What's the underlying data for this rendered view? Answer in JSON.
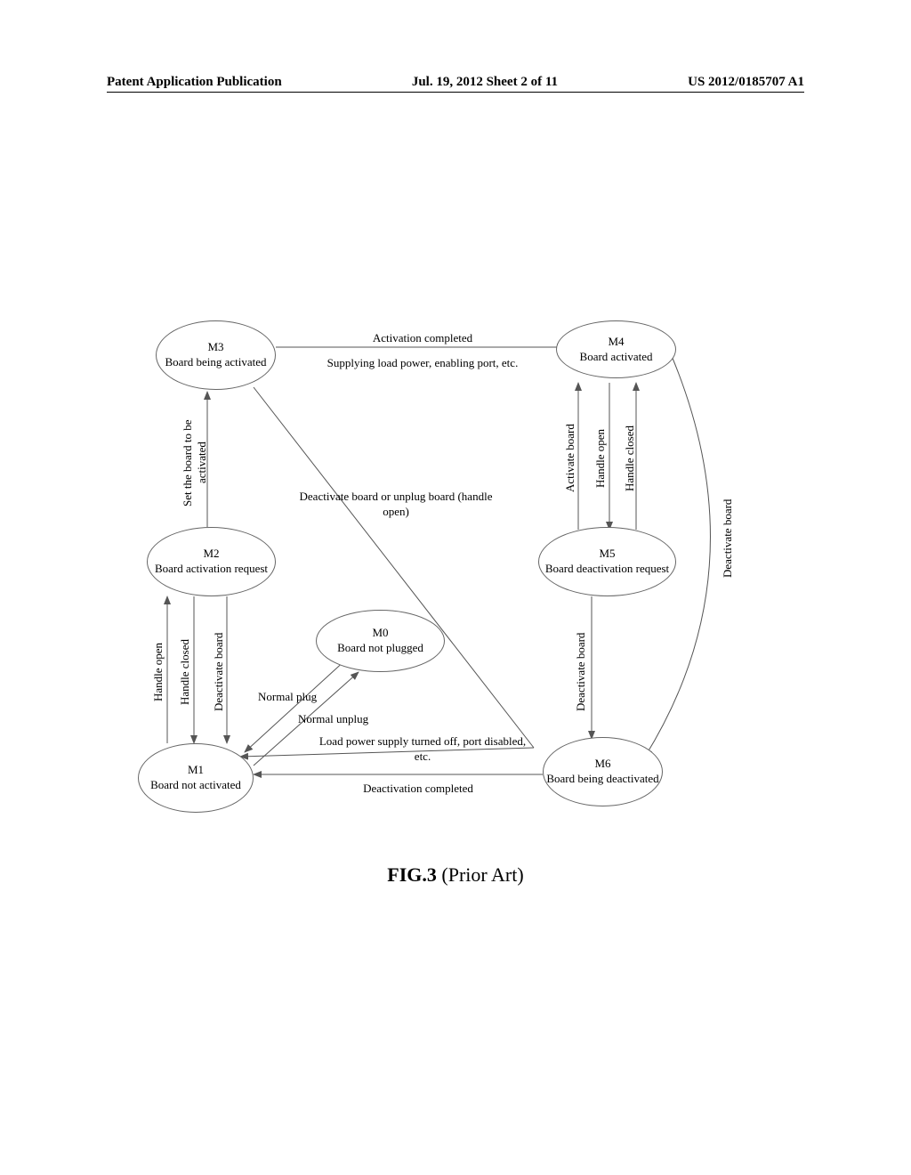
{
  "header": {
    "left": "Patent Application Publication",
    "center": "Jul. 19, 2012  Sheet 2 of 11",
    "right": "US 2012/0185707 A1"
  },
  "states": {
    "m0": {
      "id": "M0",
      "text": "Board not plugged"
    },
    "m1": {
      "id": "M1",
      "text": "Board not activated"
    },
    "m2": {
      "id": "M2",
      "text": "Board activation request"
    },
    "m3": {
      "id": "M3",
      "text": "Board being activated"
    },
    "m4": {
      "id": "M4",
      "text": "Board activated"
    },
    "m5": {
      "id": "M5",
      "text": "Board deactivation request"
    },
    "m6": {
      "id": "M6",
      "text": "Board being deactivated"
    }
  },
  "transitions": {
    "m3_m4_top": "Activation completed",
    "m3_m4_bottom": "Supplying load power, enabling port, etc.",
    "m2_m3": "Set the board to be activated",
    "m3_m1_diag": "Deactivate board or unplug board (handle open)",
    "m1_m2_a": "Handle open",
    "m1_m2_b": "Handle closed",
    "m2_m1": "Deactivate board",
    "m0_m1": "Normal plug",
    "m1_m0": "Normal unplug",
    "m6_m1_top": "Load power supply turned off, port disabled, etc.",
    "m6_m1_bottom": "Deactivation completed",
    "m4_m5_a": "Handle open",
    "m4_m5_b": "Handle closed",
    "m5_m4": "Activate board",
    "m5_m6": "Deactivate board",
    "m4_m6": "Deactivate board"
  },
  "figure": {
    "label": "FIG.3",
    "note": "(Prior Art)"
  }
}
